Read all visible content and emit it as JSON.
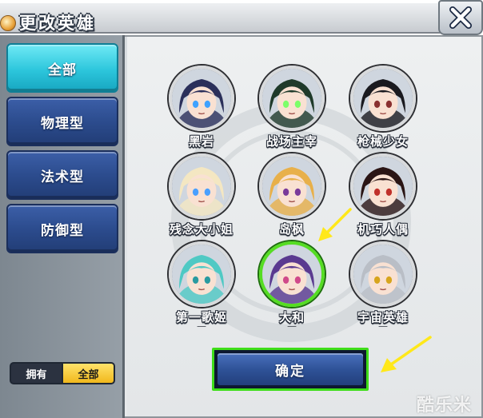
{
  "window": {
    "title": "更改英雄"
  },
  "sidebar": {
    "filters": [
      {
        "label": "全部",
        "active": true
      },
      {
        "label": "物理型",
        "active": false
      },
      {
        "label": "法术型",
        "active": false
      },
      {
        "label": "防御型",
        "active": false
      }
    ],
    "owned_toggle": {
      "owned_label": "拥有",
      "all_label": "全部",
      "selected": "全部"
    }
  },
  "heroes": [
    {
      "name": "黑岩",
      "hair": "#2a2f5a",
      "eyes": "#3fa2ff"
    },
    {
      "name": "战场主宰",
      "hair": "#1f3a2a",
      "eyes": "#7cff6a"
    },
    {
      "name": "枪械少女",
      "hair": "#1a1a1f",
      "eyes": "#8a3030"
    },
    {
      "name": "残念大小姐",
      "hair": "#f4e7c2",
      "eyes": "#4aa0ff"
    },
    {
      "name": "岛枫",
      "hair": "#e8b04a",
      "eyes": "#7a3b9a"
    },
    {
      "name": "机巧人偶",
      "hair": "#2a1515",
      "eyes": "#c0302a"
    },
    {
      "name": "第一歌姬",
      "hair": "#4fc9c4",
      "eyes": "#2a9aa0",
      "dash": "—"
    },
    {
      "name": "大和",
      "hair": "#5a3a90",
      "eyes": "#d04a8a",
      "dash": "—",
      "selected": true
    },
    {
      "name": "宇宙英雄",
      "hair": "#b9bec6",
      "eyes": "#d7a51d",
      "dash": "—"
    }
  ],
  "confirm_button": {
    "label": "确定"
  },
  "watermark": "酷乐米",
  "colors": {
    "selected_highlight": "#3fdd1a",
    "annotation_arrow": "#ffe81a",
    "active_filter": "#2cc6dc"
  }
}
